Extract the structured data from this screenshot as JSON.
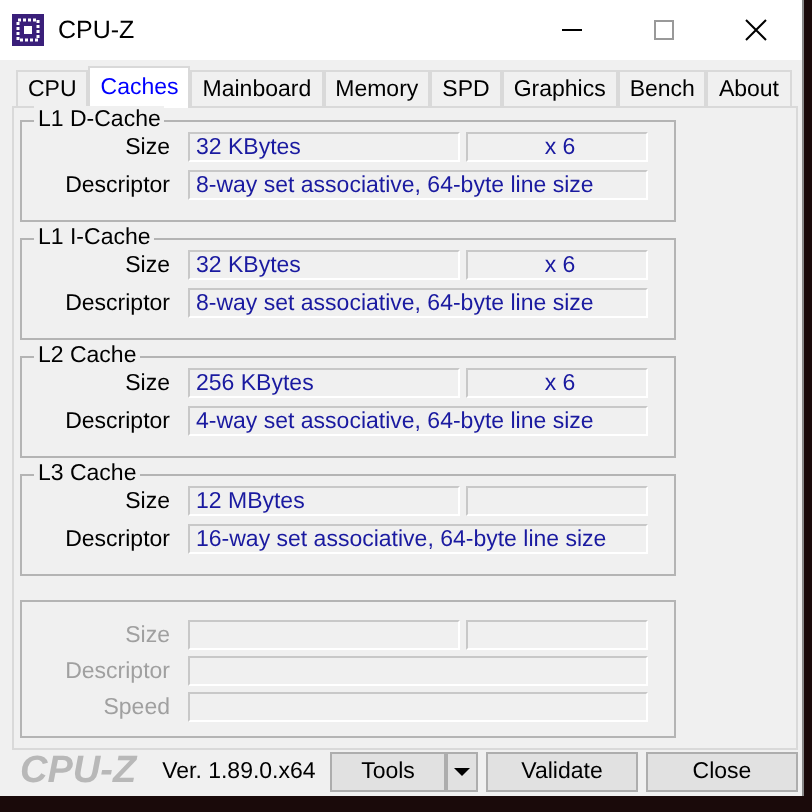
{
  "window": {
    "title": "CPU-Z"
  },
  "tabs": [
    {
      "label": "CPU",
      "selected": false
    },
    {
      "label": "Caches",
      "selected": true
    },
    {
      "label": "Mainboard",
      "selected": false
    },
    {
      "label": "Memory",
      "selected": false
    },
    {
      "label": "SPD",
      "selected": false
    },
    {
      "label": "Graphics",
      "selected": false
    },
    {
      "label": "Bench",
      "selected": false
    },
    {
      "label": "About",
      "selected": false
    }
  ],
  "cache_groups": [
    {
      "title": "L1 D-Cache",
      "disabled": false,
      "rows": [
        {
          "kind": "pair",
          "label": "Size",
          "value": "32 KBytes",
          "count": "x 6"
        },
        {
          "kind": "single",
          "label": "Descriptor",
          "value": "8-way set associative, 64-byte line size"
        }
      ]
    },
    {
      "title": "L1 I-Cache",
      "disabled": false,
      "rows": [
        {
          "kind": "pair",
          "label": "Size",
          "value": "32 KBytes",
          "count": "x 6"
        },
        {
          "kind": "single",
          "label": "Descriptor",
          "value": "8-way set associative, 64-byte line size"
        }
      ]
    },
    {
      "title": "L2 Cache",
      "disabled": false,
      "rows": [
        {
          "kind": "pair",
          "label": "Size",
          "value": "256 KBytes",
          "count": "x 6"
        },
        {
          "kind": "single",
          "label": "Descriptor",
          "value": "4-way set associative, 64-byte line size"
        }
      ]
    },
    {
      "title": "L3 Cache",
      "disabled": false,
      "rows": [
        {
          "kind": "pair",
          "label": "Size",
          "value": "12 MBytes"
        },
        {
          "kind": "single",
          "label": "Descriptor",
          "value": "16-way set associative, 64-byte line size"
        }
      ]
    },
    {
      "disabled": true,
      "rows": [
        {
          "kind": "pair",
          "label": "Size"
        },
        {
          "kind": "single",
          "label": "Descriptor"
        },
        {
          "kind": "single",
          "label": "Speed"
        }
      ]
    }
  ],
  "footer": {
    "logo": "CPU-Z",
    "version": "Ver. 1.89.0.x64",
    "buttons": [
      {
        "label": "Tools",
        "kind": "dropdown"
      },
      {
        "label": "Validate",
        "kind": "plain"
      },
      {
        "label": "Close",
        "kind": "plain"
      }
    ]
  }
}
